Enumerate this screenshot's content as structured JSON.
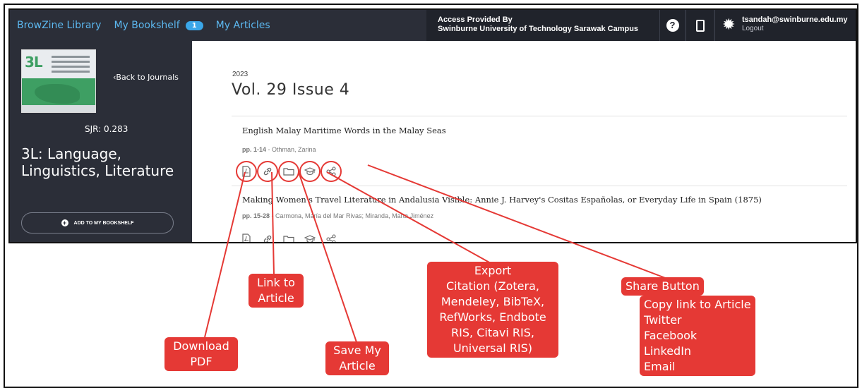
{
  "topbar": {
    "brand": "BrowZine Library",
    "bookshelf_label": "My Bookshelf",
    "bookshelf_count": "1",
    "articles_label": "My Articles",
    "access_line1": "Access Provided By",
    "access_line2": "Swinburne University of Technology Sarawak Campus",
    "user_email": "tsandah@swinburne.edu.my",
    "logout_label": "Logout",
    "help_icon": "?"
  },
  "journal": {
    "back_label": "‹Back to Journals",
    "sjr": "SJR: 0.283",
    "title": "3L: Language, Linguistics, Literature",
    "add_label": "ADD TO MY BOOKSHELF",
    "cover_text": "3L"
  },
  "issue": {
    "year": "2023",
    "title": "Vol. 29 Issue 4"
  },
  "articles": [
    {
      "title": "English Malay Maritime Words in the Malay Seas",
      "pages": "pp. 1-14",
      "authors": "Othman, Zarina"
    },
    {
      "title": "Making Women's Travel Literature in Andalusia Visible: Annie J. Harvey's Cositas Españolas, or Everyday Life in Spain (1875)",
      "pages": "pp. 15-28",
      "authors": "Carmona, María del Mar Rivas; Miranda, Marta Jiménez"
    }
  ],
  "annotations": {
    "download_pdf": [
      "Download",
      "PDF"
    ],
    "link_article": [
      "Link to",
      "Article"
    ],
    "save_article": [
      "Save My",
      "Article"
    ],
    "export_citation": [
      "Export",
      "Citation (Zotera,",
      "Mendeley, BibTeX,",
      "RefWorks, Endbote",
      "RIS, Citavi RIS,",
      "Universal RIS)"
    ],
    "share_button": [
      "Share Button"
    ],
    "share_options": [
      "Copy link to Article",
      "Twitter",
      "Facebook",
      "LinkedIn",
      "Email"
    ]
  },
  "colors": {
    "accent_red": "#e53935",
    "topbar": "#2b2e38",
    "link_blue": "#5cb8f0"
  }
}
